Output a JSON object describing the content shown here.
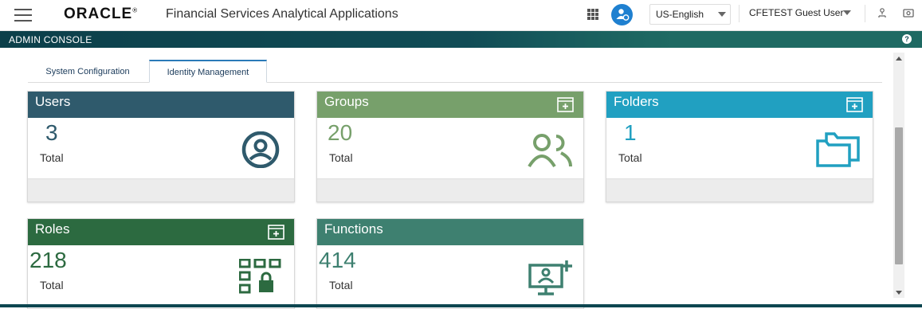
{
  "header": {
    "menu_icon": "hamburger-icon",
    "logo_text": "ORACLE",
    "logo_mark": "®",
    "app_title": "Financial Services Analytical Applications",
    "apps_icon": "grid-icon",
    "user_icon": "user-circle-icon",
    "language": "US-English",
    "user_name": "CFETEST Guest User",
    "tools_icons": [
      "hierarchy-icon",
      "screen-icon"
    ]
  },
  "banner": {
    "title": "ADMIN CONSOLE",
    "help_icon": "?"
  },
  "tabs": [
    {
      "label": "System Configuration",
      "active": false
    },
    {
      "label": "Identity Management",
      "active": true
    }
  ],
  "cards": [
    {
      "title": "Users",
      "count": "3",
      "total_label": "Total",
      "color": "#2f5a6c",
      "icon": "user-circle-icon",
      "has_add": false
    },
    {
      "title": "Groups",
      "count": "20",
      "total_label": "Total",
      "color": "#77a06b",
      "icon": "users-icon",
      "has_add": true
    },
    {
      "title": "Folders",
      "count": "1",
      "total_label": "Total",
      "color": "#21a0c1",
      "icon": "folders-icon",
      "has_add": true
    },
    {
      "title": "Roles",
      "count": "218",
      "total_label": "Total",
      "color": "#2c6a40",
      "icon": "roles-grid-icon",
      "has_add": true
    },
    {
      "title": "Functions",
      "count": "414",
      "total_label": "Total",
      "color": "#3e8070",
      "icon": "monitor-add-icon",
      "has_add": false
    }
  ]
}
